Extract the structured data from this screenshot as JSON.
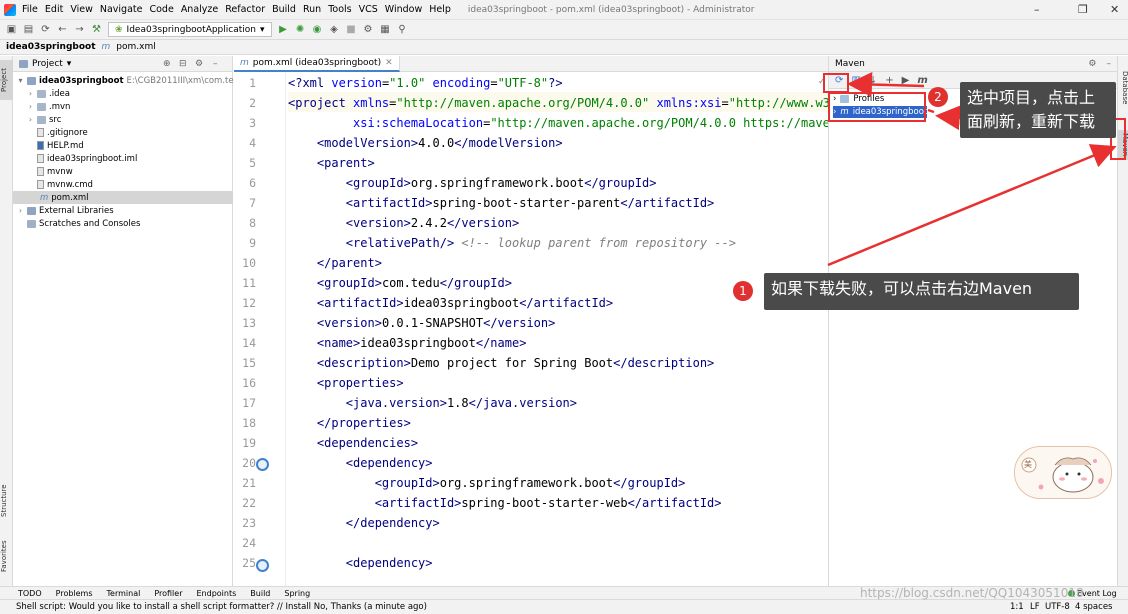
{
  "menu": {
    "items": [
      "File",
      "Edit",
      "View",
      "Navigate",
      "Code",
      "Analyze",
      "Refactor",
      "Build",
      "Run",
      "Tools",
      "VCS",
      "Window",
      "Help"
    ],
    "window_title": "idea03springboot - pom.xml (idea03springboot) - Administrator"
  },
  "toolbar": {
    "run_config": "Idea03springbootApplication"
  },
  "breadcrumb": {
    "project": "idea03springboot",
    "file": "pom.xml"
  },
  "project_panel": {
    "title": "Project",
    "root": {
      "name": "idea03springboot",
      "path": "E:\\CGB2011III\\xm\\com.tedu.0"
    },
    "items": [
      {
        "label": ".idea",
        "kind": "folder"
      },
      {
        "label": ".mvn",
        "kind": "folder"
      },
      {
        "label": "src",
        "kind": "folder"
      },
      {
        "label": ".gitignore",
        "kind": "file"
      },
      {
        "label": "HELP.md",
        "kind": "file"
      },
      {
        "label": "idea03springboot.iml",
        "kind": "file"
      },
      {
        "label": "mvnw",
        "kind": "file"
      },
      {
        "label": "mvnw.cmd",
        "kind": "file"
      },
      {
        "label": "pom.xml",
        "kind": "file"
      }
    ],
    "external_libraries": "External Libraries",
    "scratches": "Scratches and Consoles"
  },
  "side_tabs": {
    "project": "Project",
    "structure": "Structure",
    "favorites": "Favorites",
    "maven": "Maven",
    "database": "Database"
  },
  "editor": {
    "tab_label": "pom.xml (idea03springboot)",
    "line_numbers": [
      "1",
      "2",
      "3",
      "4",
      "5",
      "6",
      "7",
      "8",
      "9",
      "10",
      "11",
      "12",
      "13",
      "14",
      "15",
      "16",
      "17",
      "18",
      "19",
      "20",
      "21",
      "22",
      "23",
      "24",
      "25"
    ],
    "lines": [
      [
        {
          "c": "tag",
          "t": "<?"
        },
        {
          "c": "tag",
          "t": "xml "
        },
        {
          "c": "an",
          "t": "version"
        },
        {
          "c": "tx",
          "t": "="
        },
        {
          "c": "av",
          "t": "\"1.0\" "
        },
        {
          "c": "an",
          "t": "encoding"
        },
        {
          "c": "tx",
          "t": "="
        },
        {
          "c": "av",
          "t": "\"UTF-8\""
        },
        {
          "c": "tag",
          "t": "?>"
        }
      ],
      [
        {
          "c": "tag",
          "t": "<project "
        },
        {
          "c": "an",
          "t": "xmlns"
        },
        {
          "c": "tx",
          "t": "="
        },
        {
          "c": "av",
          "t": "\"http://maven.apache.org/POM/4.0.0\" "
        },
        {
          "c": "an",
          "t": "xmlns:xsi"
        },
        {
          "c": "tx",
          "t": "="
        },
        {
          "c": "av",
          "t": "\"http://www.w3.org/2001/XMLSchema-instance\""
        }
      ],
      [
        {
          "c": "tx",
          "t": "         "
        },
        {
          "c": "an",
          "t": "xsi:schemaLocation"
        },
        {
          "c": "tx",
          "t": "="
        },
        {
          "c": "av",
          "t": "\"http://maven.apache.org/POM/4.0.0 https://maven.apache.org/xsd/maven-4.0.0.xsd\""
        },
        {
          "c": "tag",
          "t": ">"
        }
      ],
      [
        {
          "c": "tx",
          "t": "    "
        },
        {
          "c": "tag",
          "t": "<modelVersion>"
        },
        {
          "c": "tx",
          "t": "4.0.0"
        },
        {
          "c": "tag",
          "t": "</modelVersion>"
        }
      ],
      [
        {
          "c": "tx",
          "t": "    "
        },
        {
          "c": "tag",
          "t": "<parent>"
        }
      ],
      [
        {
          "c": "tx",
          "t": "        "
        },
        {
          "c": "tag",
          "t": "<groupId>"
        },
        {
          "c": "tx",
          "t": "org.springframework.boot"
        },
        {
          "c": "tag",
          "t": "</groupId>"
        }
      ],
      [
        {
          "c": "tx",
          "t": "        "
        },
        {
          "c": "tag",
          "t": "<artifactId>"
        },
        {
          "c": "tx",
          "t": "spring-boot-starter-parent"
        },
        {
          "c": "tag",
          "t": "</artifactId>"
        }
      ],
      [
        {
          "c": "tx",
          "t": "        "
        },
        {
          "c": "tag",
          "t": "<version>"
        },
        {
          "c": "tx",
          "t": "2.4.2"
        },
        {
          "c": "tag",
          "t": "</version>"
        }
      ],
      [
        {
          "c": "tx",
          "t": "        "
        },
        {
          "c": "tag",
          "t": "<relativePath/>"
        },
        {
          "c": "tx",
          "t": " "
        },
        {
          "c": "cm",
          "t": "<!-- lookup parent from repository -->"
        }
      ],
      [
        {
          "c": "tx",
          "t": "    "
        },
        {
          "c": "tag",
          "t": "</parent>"
        }
      ],
      [
        {
          "c": "tx",
          "t": "    "
        },
        {
          "c": "tag",
          "t": "<groupId>"
        },
        {
          "c": "tx",
          "t": "com.tedu"
        },
        {
          "c": "tag",
          "t": "</groupId>"
        }
      ],
      [
        {
          "c": "tx",
          "t": "    "
        },
        {
          "c": "tag",
          "t": "<artifactId>"
        },
        {
          "c": "tx",
          "t": "idea03springboot"
        },
        {
          "c": "tag",
          "t": "</artifactId>"
        }
      ],
      [
        {
          "c": "tx",
          "t": "    "
        },
        {
          "c": "tag",
          "t": "<version>"
        },
        {
          "c": "tx",
          "t": "0.0.1-SNAPSHOT"
        },
        {
          "c": "tag",
          "t": "</version>"
        }
      ],
      [
        {
          "c": "tx",
          "t": "    "
        },
        {
          "c": "tag",
          "t": "<name>"
        },
        {
          "c": "tx",
          "t": "idea03springboot"
        },
        {
          "c": "tag",
          "t": "</name>"
        }
      ],
      [
        {
          "c": "tx",
          "t": "    "
        },
        {
          "c": "tag",
          "t": "<description>"
        },
        {
          "c": "tx",
          "t": "Demo project for Spring Boot"
        },
        {
          "c": "tag",
          "t": "</description>"
        }
      ],
      [
        {
          "c": "tx",
          "t": "    "
        },
        {
          "c": "tag",
          "t": "<properties>"
        }
      ],
      [
        {
          "c": "tx",
          "t": "        "
        },
        {
          "c": "tag",
          "t": "<java.version>"
        },
        {
          "c": "tx",
          "t": "1.8"
        },
        {
          "c": "tag",
          "t": "</java.version>"
        }
      ],
      [
        {
          "c": "tx",
          "t": "    "
        },
        {
          "c": "tag",
          "t": "</properties>"
        }
      ],
      [
        {
          "c": "tx",
          "t": "    "
        },
        {
          "c": "tag",
          "t": "<dependencies>"
        }
      ],
      [
        {
          "c": "tx",
          "t": "        "
        },
        {
          "c": "tag",
          "t": "<dependency>"
        }
      ],
      [
        {
          "c": "tx",
          "t": "            "
        },
        {
          "c": "tag",
          "t": "<groupId>"
        },
        {
          "c": "tx",
          "t": "org.springframework.boot"
        },
        {
          "c": "tag",
          "t": "</groupId>"
        }
      ],
      [
        {
          "c": "tx",
          "t": "            "
        },
        {
          "c": "tag",
          "t": "<artifactId>"
        },
        {
          "c": "tx",
          "t": "spring-boot-starter-web"
        },
        {
          "c": "tag",
          "t": "</artifactId>"
        }
      ],
      [
        {
          "c": "tx",
          "t": "        "
        },
        {
          "c": "tag",
          "t": "</dependency>"
        }
      ],
      [
        {
          "c": "tx",
          "t": ""
        }
      ],
      [
        {
          "c": "tx",
          "t": "        "
        },
        {
          "c": "tag",
          "t": "<dependency>"
        }
      ]
    ]
  },
  "maven_panel": {
    "title": "Maven",
    "items": [
      "Profiles",
      "idea03springboot"
    ]
  },
  "bottom_tools": [
    "TODO",
    "Problems",
    "Terminal",
    "Profiler",
    "Endpoints",
    "Build",
    "Spring"
  ],
  "event_log": "Event Log",
  "status": {
    "message": "Shell script: Would you like to install a shell script formatter? // Install   No, Thanks (a minute ago)",
    "position": "1:1",
    "line_sep": "LF",
    "encoding": "UTF-8",
    "indent": "4 spaces"
  },
  "annotations": {
    "step1_num": "1",
    "step1_text": "如果下载失败，可以点击右边Maven",
    "step2_num": "2",
    "step2_line1": "选中项目，点击上",
    "step2_line2": "面刷新，重新下载"
  },
  "sticker": {
    "label": "美"
  },
  "watermark": "https://blog.csdn.net/QQ1043051018",
  "colors": {
    "accent": "#2f65ca",
    "annotation_red": "#e83030",
    "callout_bg": "#4a4a4a"
  }
}
